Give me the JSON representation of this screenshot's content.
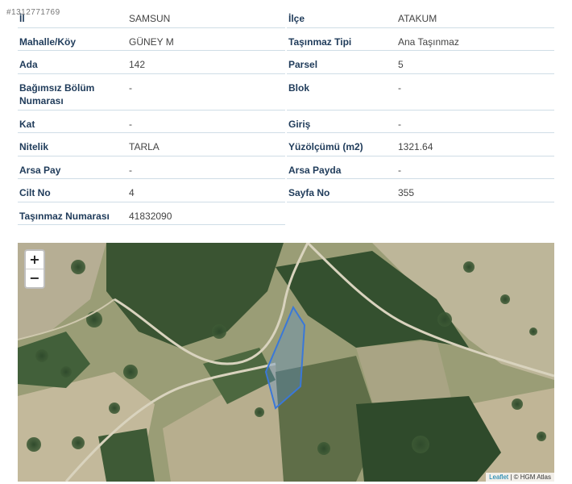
{
  "watermark": "#1312771769",
  "left_rows": [
    {
      "label": "İl",
      "value": "SAMSUN"
    },
    {
      "label": "Mahalle/Köy",
      "value": "GÜNEY M"
    },
    {
      "label": "Ada",
      "value": "142"
    },
    {
      "label": "Bağımsız Bölüm Numarası",
      "value": "-"
    },
    {
      "label": "Kat",
      "value": "-"
    },
    {
      "label": "Nitelik",
      "value": "TARLA"
    },
    {
      "label": "Arsa Pay",
      "value": "-"
    },
    {
      "label": "Cilt No",
      "value": "4"
    },
    {
      "label": "Taşınmaz Numarası",
      "value": "41832090"
    }
  ],
  "right_rows": [
    {
      "label": "İlçe",
      "value": "ATAKUM"
    },
    {
      "label": "Taşınmaz Tipi",
      "value": "Ana Taşınmaz"
    },
    {
      "label": "Parsel",
      "value": "5"
    },
    {
      "label": "Blok",
      "value": "-"
    },
    {
      "label": "Giriş",
      "value": "-"
    },
    {
      "label": "Yüzölçümü (m2)",
      "value": "1321.64"
    },
    {
      "label": "Arsa Payda",
      "value": "-"
    },
    {
      "label": "Sayfa No",
      "value": "355"
    }
  ],
  "map": {
    "zoom_in_label": "+",
    "zoom_out_label": "−",
    "attribution_link": "Leaflet",
    "attribution_separator": " | © ",
    "attribution_source": "HGM Atlas",
    "parcel_stroke_color": "#3a78d8"
  }
}
